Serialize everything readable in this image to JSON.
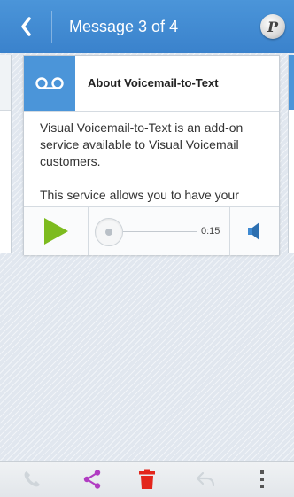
{
  "header": {
    "back_icon": "chevron-left-icon",
    "title": "Message 3 of 4",
    "action_icon": "p-badge-icon",
    "action_letter": "P",
    "color": "#3f8ad2"
  },
  "card": {
    "icon": "voicemail-icon",
    "title": "About Voicemail-to-Text",
    "body": [
      "Visual Voicemail-to-Text is an add-on service available to Visual Voicemail customers.",
      "This service allows you to have your voicemail automatically"
    ]
  },
  "player": {
    "play_icon": "play-icon",
    "play_color": "#7dbb1f",
    "progress_fraction": 0,
    "duration": "0:15",
    "volume_icon": "speaker-icon",
    "volume_color": "#3f8ad2"
  },
  "toolbar": {
    "items": [
      {
        "icon": "phone-call-icon",
        "enabled": false
      },
      {
        "icon": "share-icon",
        "enabled": true,
        "color": "#b13cc2"
      },
      {
        "icon": "trash-icon",
        "enabled": true,
        "color": "#e3261c"
      },
      {
        "icon": "reply-icon",
        "enabled": false
      },
      {
        "icon": "more-vert-icon",
        "enabled": true
      }
    ]
  }
}
